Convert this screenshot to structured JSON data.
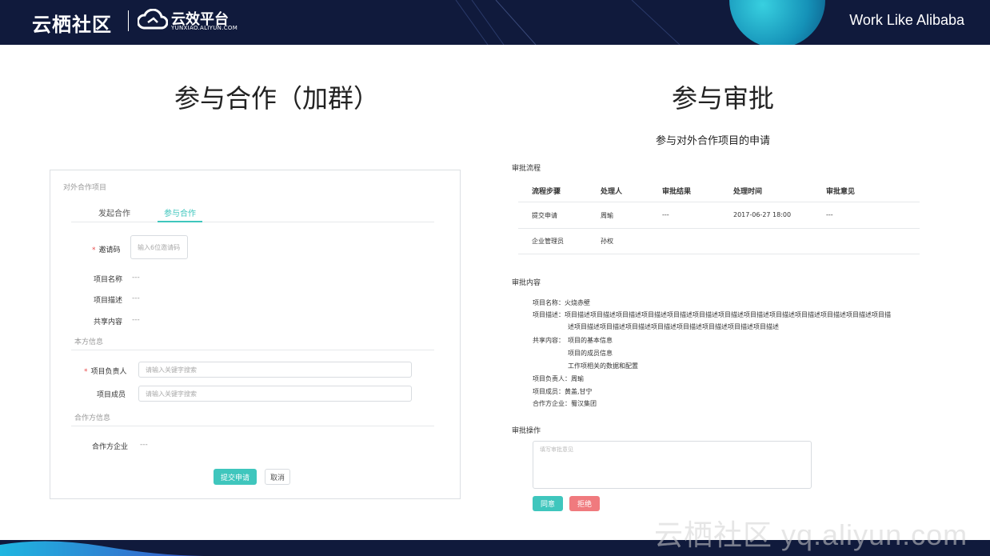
{
  "header": {
    "brand": "云栖社区",
    "product": "云效平台",
    "product_sub": "YUNXIAO.ALIYUN.COM",
    "slogan": "Work Like Alibaba"
  },
  "watermark": "云栖社区 yq.aliyun.com",
  "left": {
    "title": "参与合作（加群）",
    "panel_title": "对外合作项目",
    "tabs": [
      {
        "label": "发起合作",
        "active": false
      },
      {
        "label": "参与合作",
        "active": true
      }
    ],
    "invite_label": "邀请码",
    "invite_placeholder": "输入6位邀请码",
    "project_name_label": "项目名称",
    "project_name_value": "---",
    "project_desc_label": "项目描述",
    "project_desc_value": "---",
    "shared_label": "共享内容",
    "shared_value": "---",
    "our_info": "本方信息",
    "owner_label": "项目负责人",
    "owner_placeholder": "请输入关键字搜索",
    "members_label": "项目成员",
    "members_placeholder": "请输入关键字搜索",
    "partner_info": "合作方信息",
    "partner_company_label": "合作方企业",
    "partner_company_value": "---",
    "submit": "提交申请",
    "cancel": "取消",
    "accent": "#3fc6bd"
  },
  "right": {
    "title": "参与审批",
    "subtitle": "参与对外合作项目的申请",
    "flow_section": "审批流程",
    "flow_headers": [
      "流程步骤",
      "处理人",
      "审批结果",
      "处理时间",
      "审批意见"
    ],
    "flow_rows": [
      [
        "提交申请",
        "周瑜",
        "---",
        "2017-06-27 18:00",
        "---"
      ],
      [
        "企业管理员",
        "孙权",
        "",
        "",
        ""
      ]
    ],
    "content_section": "审批内容",
    "content": {
      "name_label": "项目名称：",
      "name": "火烧赤壁",
      "desc_label": "项目描述：",
      "desc_line1": "项目描述项目描述项目描述项目描述项目描述项目描述项目描述项目描述项目描述项目描述项目描述项目描述项目描",
      "desc_line2": "述项目描述项目描述项目描述项目描述项目描述项目描述项目描述项目描述",
      "shared_label": "共享内容：",
      "shared": [
        "项目的基本信息",
        "项目的成员信息",
        "工作项相关的数据和配置"
      ],
      "owner_label": "项目负责人：",
      "owner": "周瑜",
      "members_label": "项目成员：",
      "members": "黄盖,甘宁",
      "company_label": "合作方企业：",
      "company": "蜀汉集团"
    },
    "op_section": "审批操作",
    "opinion_placeholder": "填写审批意见",
    "agree": "同意",
    "reject": "拒绝",
    "agree_color": "#3fc6bd",
    "reject_color": "#f07a7e"
  }
}
